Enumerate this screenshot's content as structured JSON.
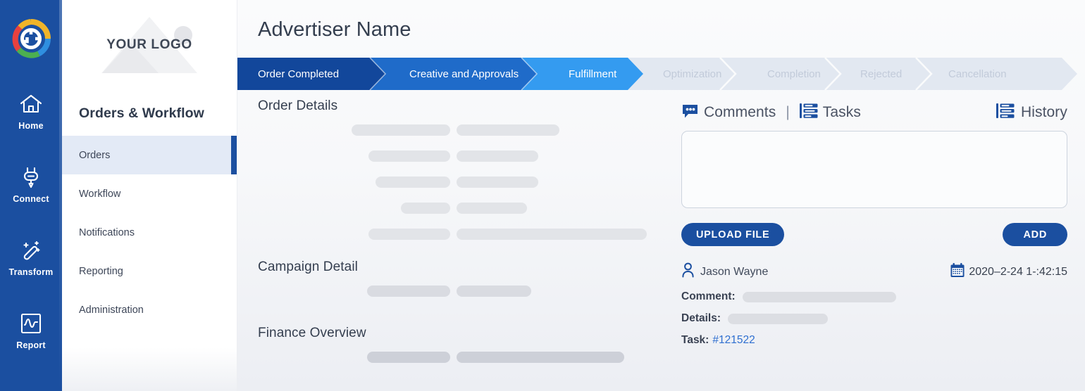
{
  "colors": {
    "rail_bg": "#1B4FA0",
    "accent": "#1B4FA0",
    "step_active_1": "#12479B",
    "step_active_2": "#1F6BC9",
    "step_active_3": "#349BF0",
    "step_inactive": "#E2E8F1",
    "link": "#2F6FD0",
    "skeleton": "#E2E4E8"
  },
  "rail": {
    "logo_icon": "donut-chart-logo-icon",
    "items": [
      {
        "label": "Home",
        "icon": "home-icon"
      },
      {
        "label": "Connect",
        "icon": "plug-icon"
      },
      {
        "label": "Transform",
        "icon": "magic-wand-icon"
      },
      {
        "label": "Report",
        "icon": "pulse-chart-icon"
      }
    ]
  },
  "sidenav": {
    "brand_text": "YOUR LOGO",
    "title": "Orders & Workflow",
    "items": [
      {
        "label": "Orders",
        "active": true
      },
      {
        "label": "Workflow",
        "active": false
      },
      {
        "label": "Notifications",
        "active": false
      },
      {
        "label": "Reporting",
        "active": false
      },
      {
        "label": "Administration",
        "active": false
      }
    ]
  },
  "header": {
    "title": "Advertiser Name"
  },
  "stepper": {
    "steps": [
      {
        "label": "Order Completed",
        "state": "done"
      },
      {
        "label": "Creative and Approvals",
        "state": "done"
      },
      {
        "label": "Fulfillment",
        "state": "current"
      },
      {
        "label": "Optimization",
        "state": "upcoming"
      },
      {
        "label": "Completion",
        "state": "upcoming"
      },
      {
        "label": "Rejected",
        "state": "upcoming"
      },
      {
        "label": "Cancellation",
        "state": "upcoming"
      }
    ]
  },
  "main_sections": [
    {
      "title": "Order Details"
    },
    {
      "title": "Campaign Detail"
    },
    {
      "title": "Finance Overview"
    }
  ],
  "panel": {
    "tab_comments": "Comments",
    "separator": "|",
    "tab_tasks": "Tasks",
    "tab_history": "History",
    "comments_icon": "speech-bubble-icon",
    "tasks_icon": "task-list-icon",
    "history_icon": "history-list-icon",
    "textarea_value": "",
    "textarea_placeholder": "",
    "upload_label": "UPLOAD FILE",
    "add_label": "ADD"
  },
  "comment_entry": {
    "user_icon": "person-icon",
    "user_name": "Jason Wayne",
    "calendar_icon": "calendar-icon",
    "timestamp": "2020–2-24 1-:42:15",
    "comment_label": "Comment:",
    "details_label": "Details:",
    "task_label": "Task:",
    "task_id": "#121522"
  }
}
